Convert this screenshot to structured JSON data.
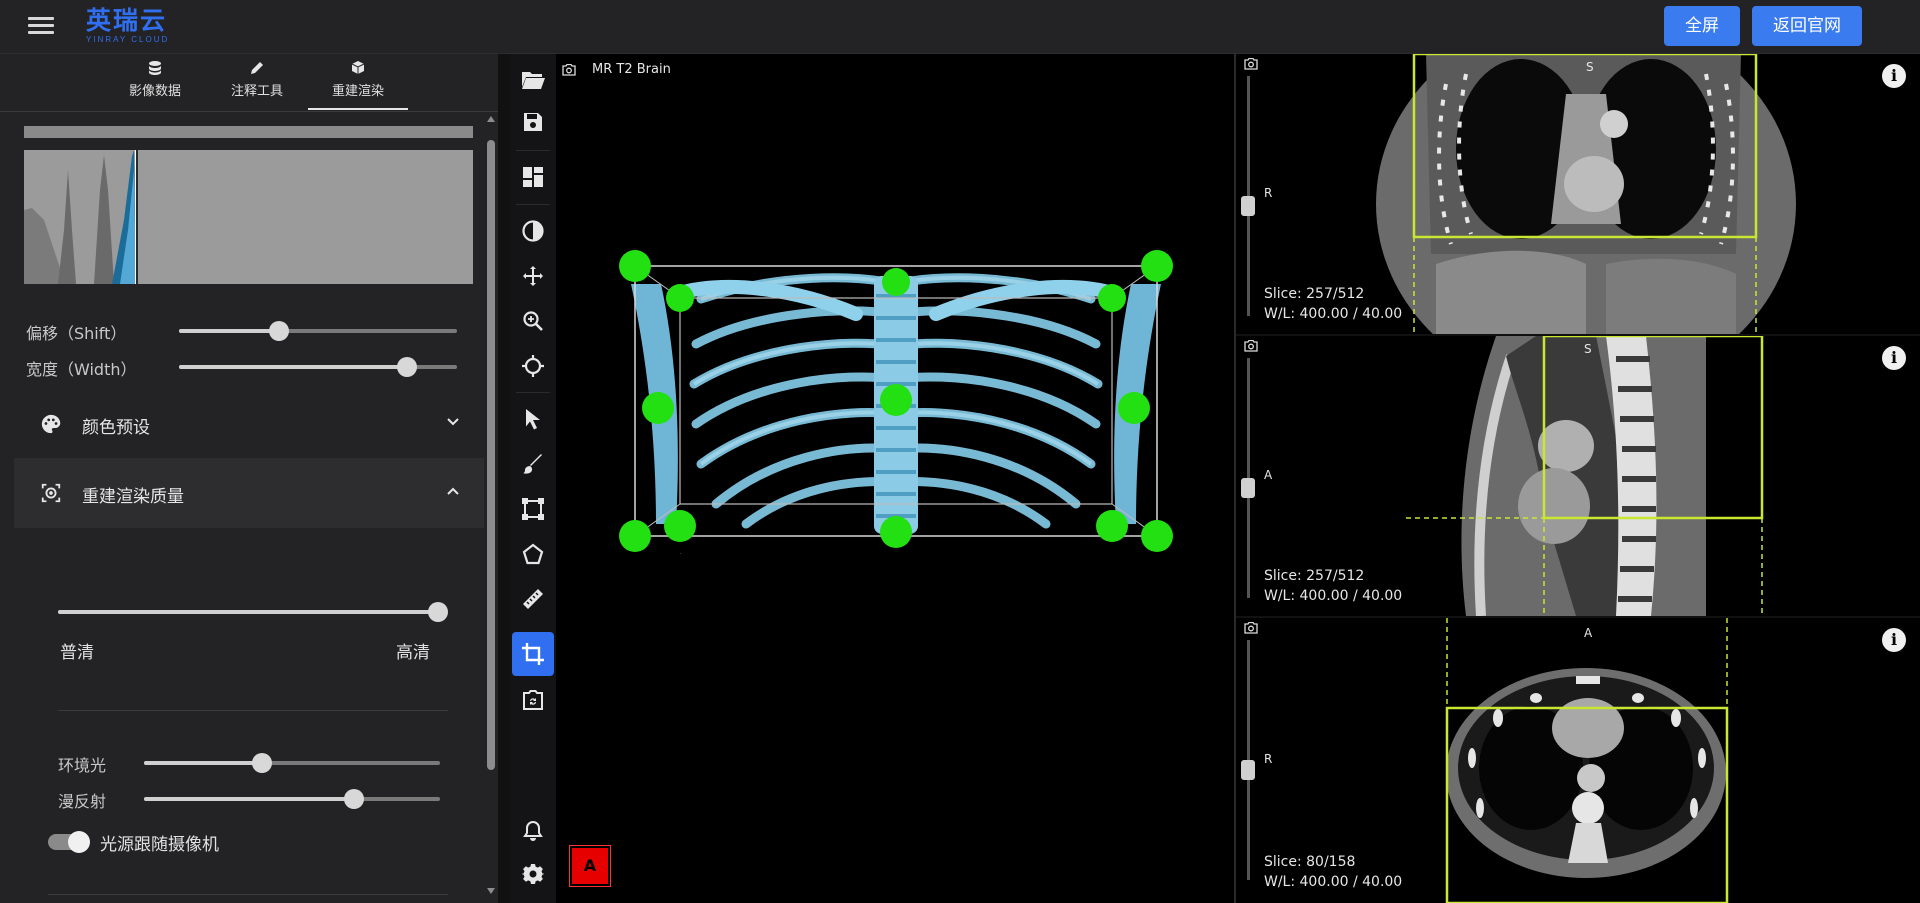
{
  "header": {
    "brand_cn": "英瑞云",
    "brand_en": "YINRAY CLOUD",
    "fullscreen_label": "全屏",
    "home_label": "返回官网"
  },
  "left_panel": {
    "tabs": [
      {
        "label": "影像数据",
        "icon": "database-icon"
      },
      {
        "label": "注释工具",
        "icon": "pencil-icon"
      },
      {
        "label": "重建渲染",
        "icon": "cube-icon",
        "active": true
      }
    ],
    "shift": {
      "label": "偏移（Shift）",
      "value": 0.36
    },
    "width": {
      "label": "宽度（Width）",
      "value": 0.82
    },
    "color_preset": {
      "label": "颜色预设",
      "expanded": false
    },
    "quality": {
      "label": "重建渲染质量",
      "expanded": true,
      "value": 1.0,
      "low_label": "普清",
      "high_label": "高清"
    },
    "ambient": {
      "label": "环境光",
      "value": 0.4
    },
    "diffuse": {
      "label": "漫反射",
      "value": 0.71
    },
    "light_follow": {
      "label": "光源跟随摄像机",
      "on": true
    }
  },
  "toolbar": {
    "tools": [
      "folder-open-icon",
      "save-icon",
      "layout-icon",
      "contrast-icon",
      "move-icon",
      "zoom-icon",
      "crosshair-icon",
      "pointer-icon",
      "brush-icon",
      "bounding-box-icon",
      "polygon-icon",
      "ruler-icon",
      "crop-icon",
      "screenshot-icon",
      "bell-icon",
      "gear-icon"
    ],
    "active_tool": "crop-icon"
  },
  "main_view": {
    "title": "MR T2 Brain",
    "orientation_marker": "A"
  },
  "viewports": [
    {
      "orientation_top": "S",
      "orientation_left": "R",
      "slice": "Slice: 257/512",
      "wl": "W/L: 400.00 / 40.00",
      "slider": 0.5
    },
    {
      "orientation_top": "S",
      "orientation_left": "A",
      "slice": "Slice: 257/512",
      "wl": "W/L: 400.00 / 40.00",
      "slider": 0.5
    },
    {
      "orientation_top": "A",
      "orientation_left": "R",
      "slice": "Slice: 80/158",
      "wl": "W/L: 400.00 / 40.00",
      "slider": 0.5
    }
  ],
  "colors": {
    "accent": "#3a7bf0",
    "handle": "#22e011",
    "crop_box": "#c9e632",
    "bone": "#7fc3e0",
    "alert": "#e60000"
  }
}
